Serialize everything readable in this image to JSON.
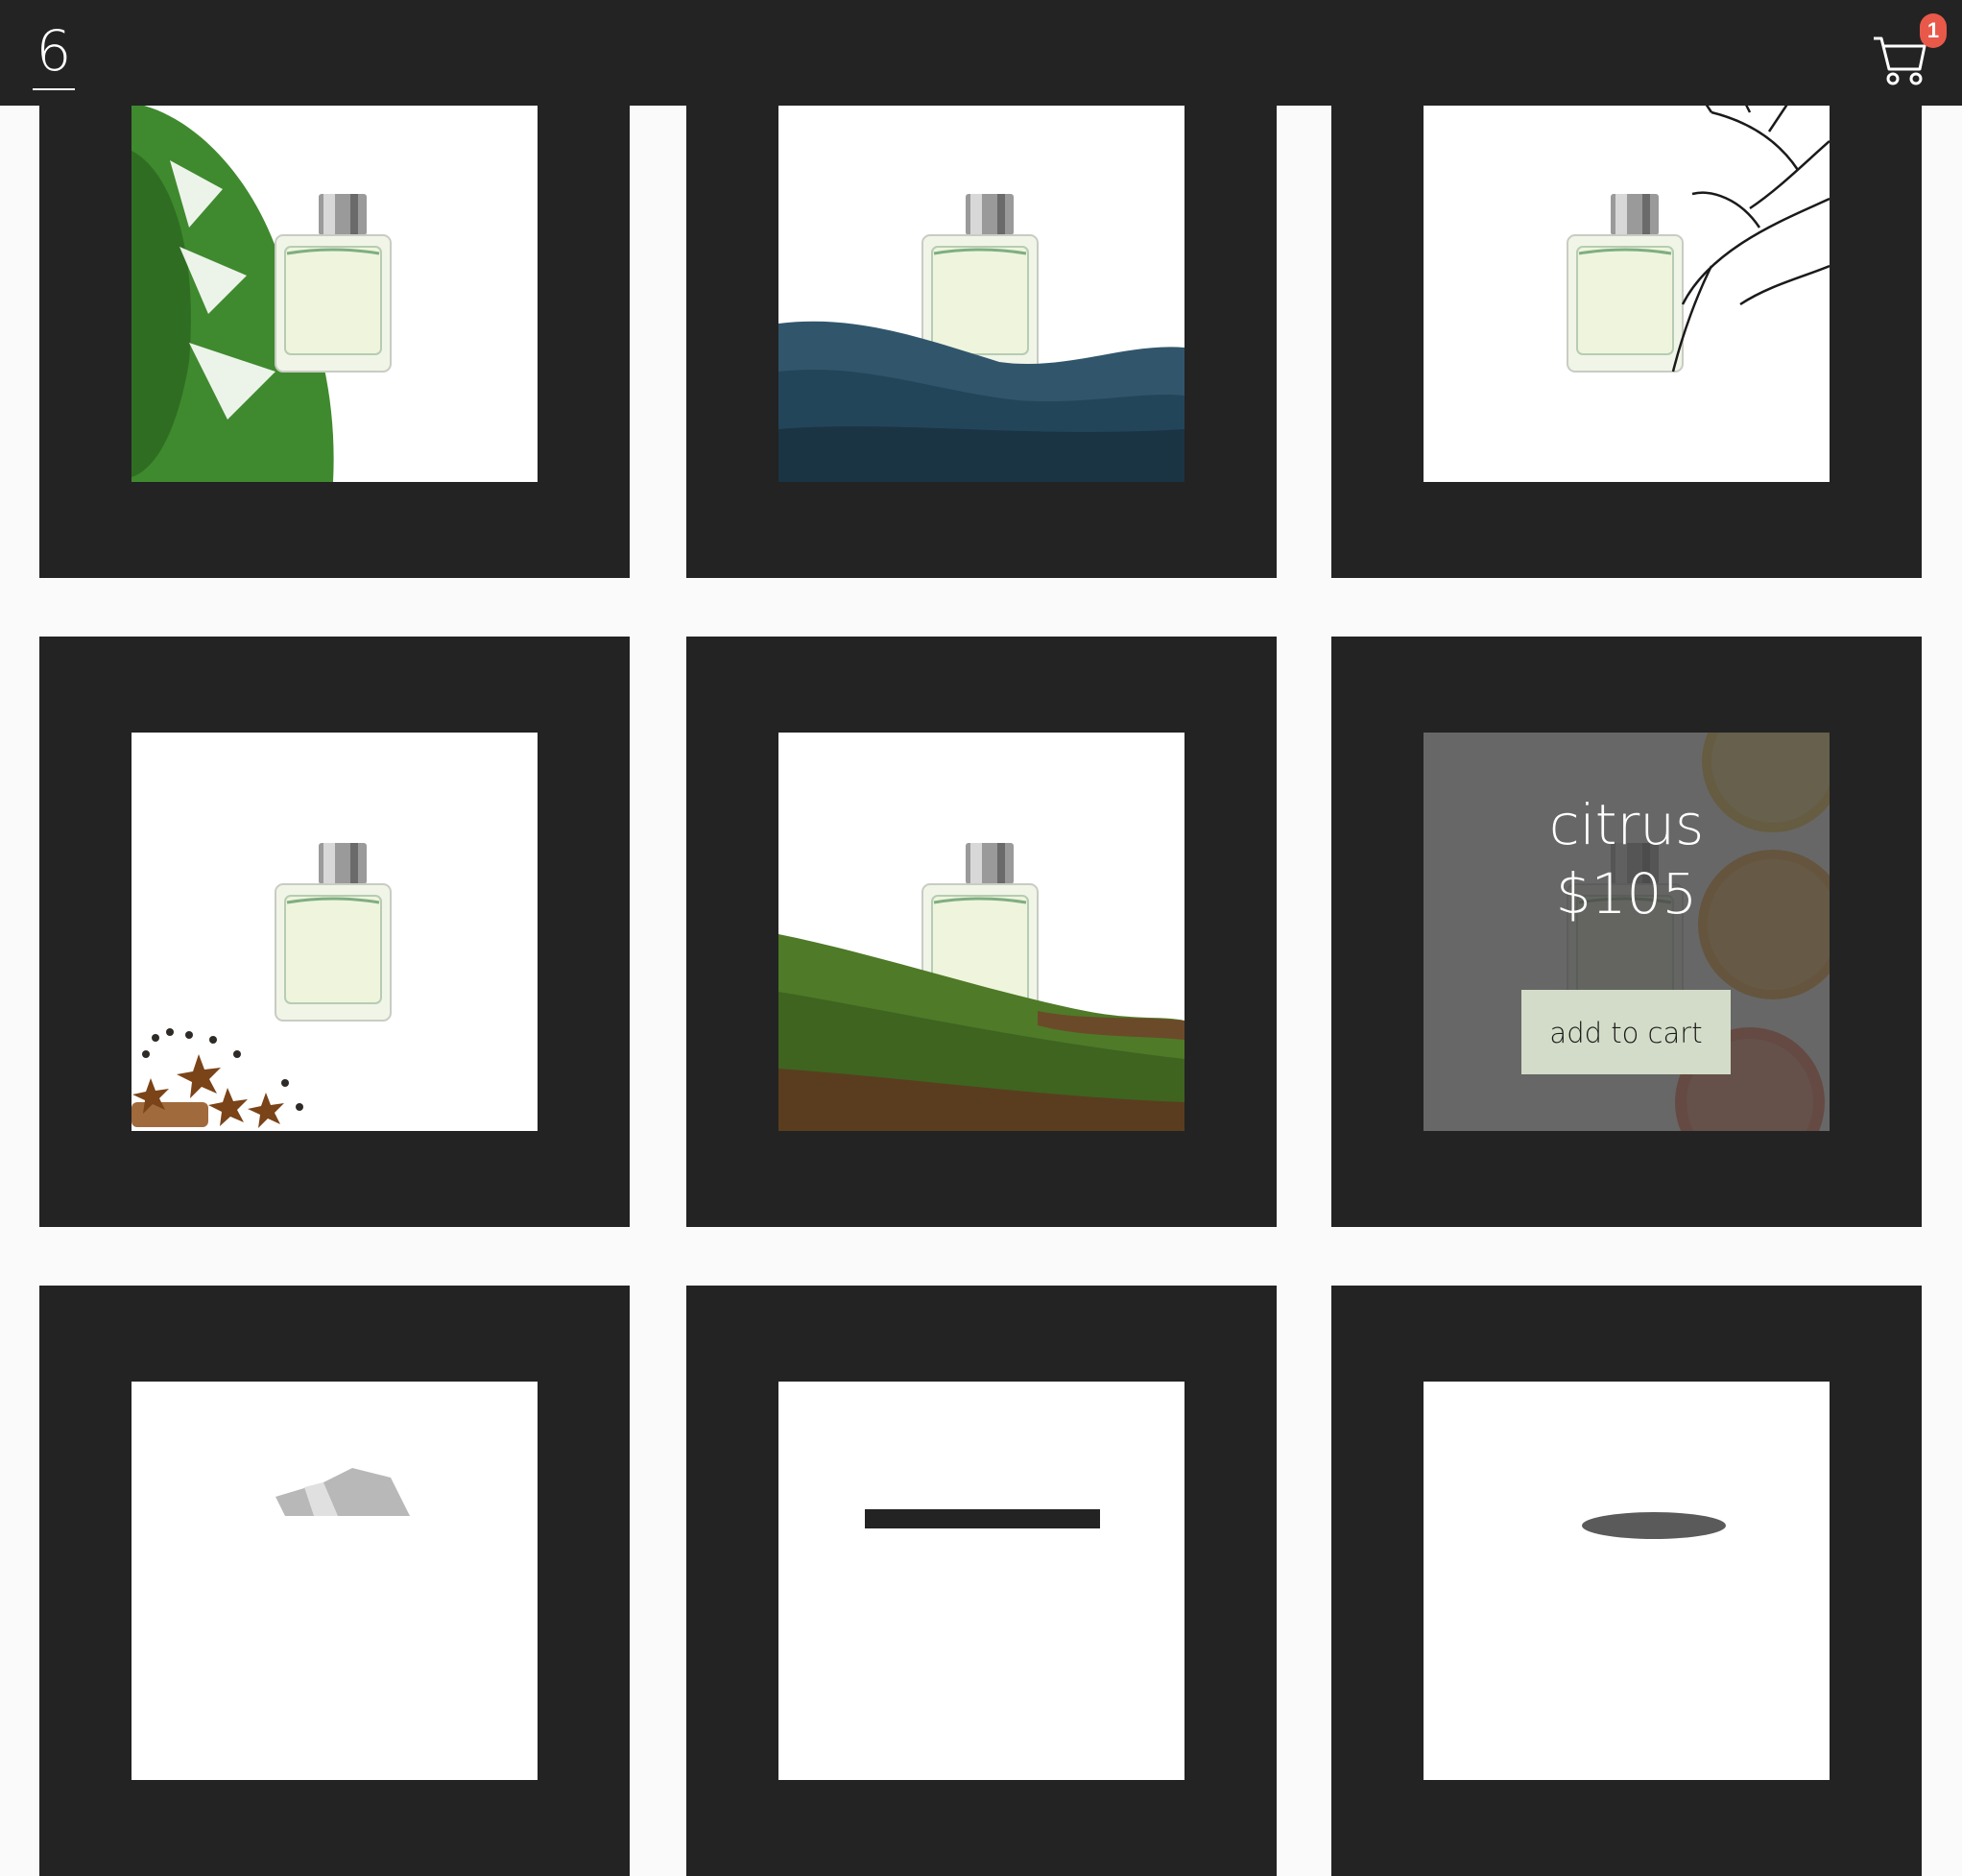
{
  "header": {
    "logo_text": "6",
    "cart_badge": "1"
  },
  "products": [
    {
      "scene": "leaf-icon"
    },
    {
      "scene": "water-icon"
    },
    {
      "scene": "branch-icon"
    },
    {
      "scene": "spice-icon"
    },
    {
      "scene": "moss-icon"
    },
    {
      "scene": "citrus-icon",
      "hover": {
        "name": "citrus",
        "price": "$105",
        "button_label": "add to cart"
      }
    },
    {
      "scene": "crystal-icon"
    },
    {
      "scene": "block-icon"
    },
    {
      "scene": "stone-icon"
    }
  ],
  "colors": {
    "background": "#fafafa",
    "card": "#232323",
    "header": "#232323",
    "badge": "#e8594a",
    "button": "#d3dcc8"
  }
}
